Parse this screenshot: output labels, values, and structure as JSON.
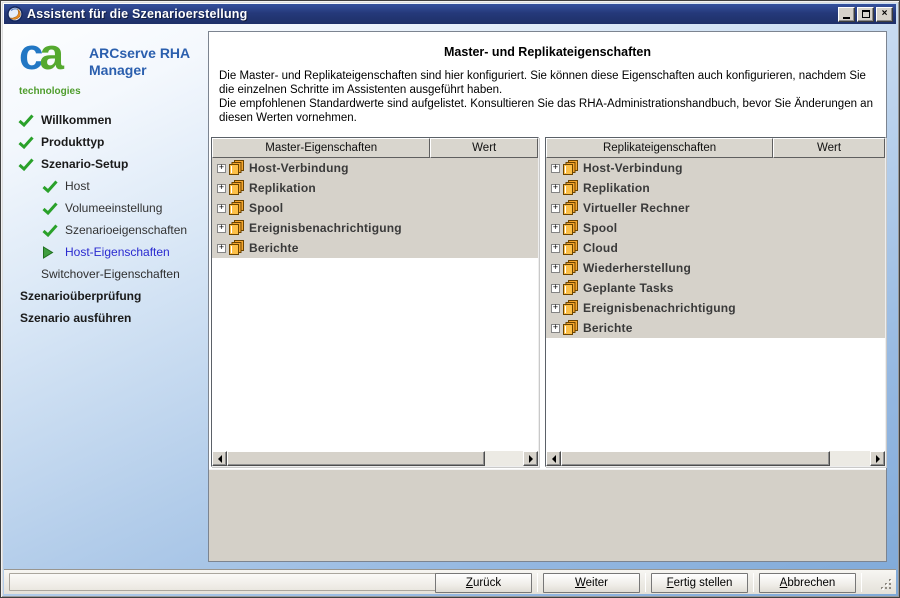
{
  "window": {
    "title": "Assistent für die Szenarioerstellung",
    "controls": {
      "minimize": "minimize-window",
      "maximize": "maximize-window",
      "close": "×"
    }
  },
  "branding": {
    "logo_c": "c",
    "logo_a": "a",
    "logo_sub": "technologies",
    "app_name": "ARCserve RHA Manager"
  },
  "sidebar": {
    "steps": [
      {
        "label": "Willkommen",
        "state": "done"
      },
      {
        "label": "Produkttyp",
        "state": "done"
      },
      {
        "label": "Szenario-Setup",
        "state": "done"
      },
      {
        "label": "Host",
        "state": "done"
      },
      {
        "label": "Volumeeinstellung",
        "state": "done"
      },
      {
        "label": "Szenarioeigenschaften",
        "state": "done"
      },
      {
        "label": "Host-Eigenschaften",
        "state": "current"
      },
      {
        "label": "Switchover-Eigenschaften",
        "state": "pending"
      },
      {
        "label": "Szenarioüberprüfung",
        "state": "pending"
      },
      {
        "label": "Szenario ausführen",
        "state": "pending"
      }
    ]
  },
  "main": {
    "heading": "Master- und Replikateigenschaften",
    "paragraphs": [
      "Die Master- und Replikateigenschaften sind hier konfiguriert. Sie können diese Eigenschaften auch konfigurieren, nachdem Sie die einzelnen Schritte im Assistenten ausgeführt haben.",
      "Die empfohlenen Standardwerte sind aufgelistet. Konsultieren Sie das RHA-Administrationshandbuch, bevor Sie Änderungen an diesen Werten vornehmen."
    ]
  },
  "panels": {
    "master": {
      "header": "Master-Eigenschaften",
      "value_header": "Wert",
      "items": [
        "Host-Verbindung",
        "Replikation",
        "Spool",
        "Ereignisbenachrichtigung",
        "Berichte"
      ]
    },
    "replica": {
      "header": "Replikateigenschaften",
      "value_header": "Wert",
      "items": [
        "Host-Verbindung",
        "Replikation",
        "Virtueller Rechner",
        "Spool",
        "Cloud",
        "Wiederherstellung",
        "Geplante Tasks",
        "Ereignisbenachrichtigung",
        "Berichte"
      ]
    }
  },
  "icons": {
    "expand": "+"
  },
  "footer": {
    "buttons": [
      "Zurück",
      "Weiter",
      "Fertig stellen",
      "Abbrechen"
    ]
  },
  "colors": {
    "titlebar_blue": "#25397a",
    "done_green": "#2aa12a",
    "current_blue": "#2a2ad0",
    "tree_icon_orange": "#f0a032",
    "panel_gray": "#d4d0c8"
  }
}
